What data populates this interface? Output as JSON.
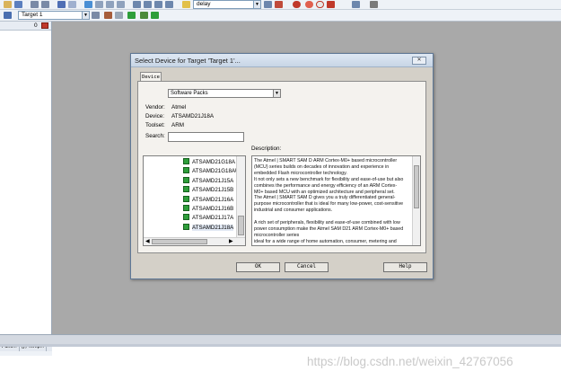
{
  "toolbar_top": {
    "search_value": "delay"
  },
  "toolbar_target": {
    "target_value": "Target 1"
  },
  "project_pane": {
    "badge": "0",
    "tabs": [
      "Func...",
      "{}₀ Temp..."
    ]
  },
  "dialog": {
    "title": "Select Device for Target 'Target 1'...",
    "close_glyph": "✕",
    "tab_label": "Device",
    "pack_select": "Software Packs",
    "vendor_label": "Vendor:",
    "vendor_value": "Atmel",
    "device_label": "Device:",
    "device_value": "ATSAMD21J18A",
    "toolset_label": "Toolset:",
    "toolset_value": "ARM",
    "search_label": "Search:",
    "search_value": "",
    "description_label": "Description:",
    "devices": [
      "ATSAMD21G18A",
      "ATSAMD21G18AU",
      "ATSAMD21J15A",
      "ATSAMD21J15B",
      "ATSAMD21J16A",
      "ATSAMD21J16B",
      "ATSAMD21J17A",
      "ATSAMD21J18A"
    ],
    "selected_device": "ATSAMD21J18A",
    "description_lines": [
      "The Atmel | SMART SAM D ARM Cortex-M0+ based microcontroller",
      "(MCU) series builds on decades of innovation and experience in",
      "embedded Flash microcontroller technology.",
      "It not only sets a new benchmark for flexibility and ease-of-use but also",
      "combines the performance and energy efficiency of an ARM Cortex-",
      "M0+ based MCU with an optimized architecture and peripheral set.",
      "The Atmel | SMART SAM D gives you a truly differentiated general-",
      "purpose microcontroller that is ideal for many low-power, cost-sensitive",
      "industrial and consumer applications.",
      "",
      "A rich set of peripherals, flexibility and ease-of-use combined with low",
      "power consumption make the Atmel SAM D21 ARM Cortex-M0+ based",
      "microcontroller series",
      "ideal for a wide range of home automation, consumer, metering and"
    ],
    "buttons": {
      "ok": "OK",
      "cancel": "Cancel",
      "help": "Help"
    }
  },
  "watermark": "https://blog.csdn.net/weixin_42767056"
}
